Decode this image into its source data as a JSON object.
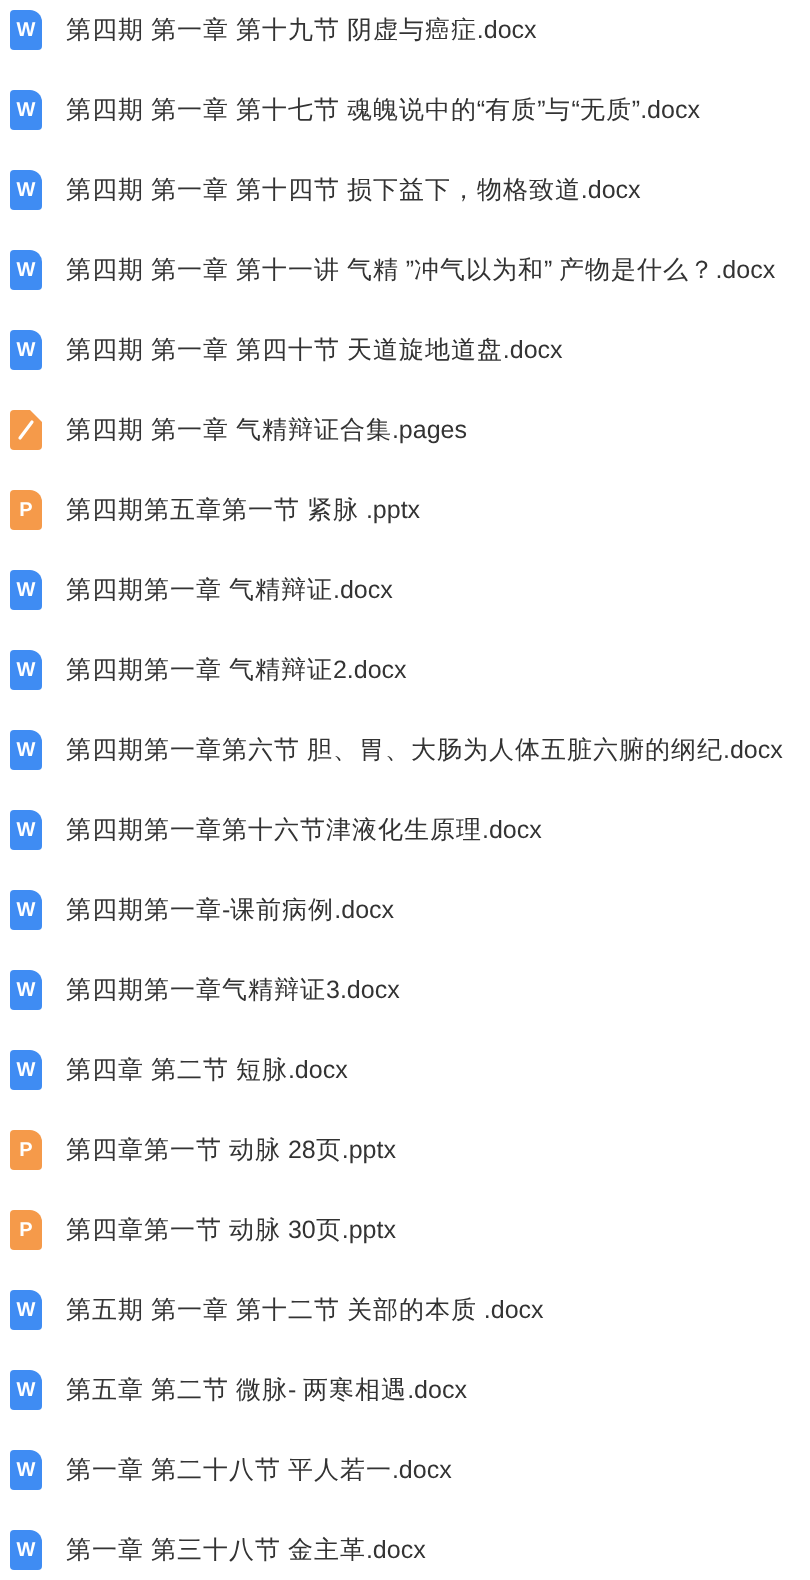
{
  "files": [
    {
      "kind": "word",
      "icon_letter": "W",
      "name": "第四期 第一章 第十九节 阴虚与癌症.docx"
    },
    {
      "kind": "word",
      "icon_letter": "W",
      "name": "第四期 第一章 第十七节 魂魄说中的“有质”与“无质”.docx"
    },
    {
      "kind": "word",
      "icon_letter": "W",
      "name": "第四期 第一章 第十四节 损下益下，物格致道.docx"
    },
    {
      "kind": "word",
      "icon_letter": "W",
      "name": "第四期 第一章 第十一讲 气精 ”冲气以为和” 产物是什么？.docx"
    },
    {
      "kind": "word",
      "icon_letter": "W",
      "name": "第四期 第一章 第四十节 天道旋地道盘.docx"
    },
    {
      "kind": "pages",
      "name": "第四期 第一章 气精辩证合集.pages"
    },
    {
      "kind": "ppt",
      "icon_letter": "P",
      "name": "第四期第五章第一节 紧脉 .pptx"
    },
    {
      "kind": "word",
      "icon_letter": "W",
      "name": "第四期第一章  气精辩证.docx"
    },
    {
      "kind": "word",
      "icon_letter": "W",
      "name": "第四期第一章 气精辩证2.docx"
    },
    {
      "kind": "word",
      "icon_letter": "W",
      "name": "第四期第一章第六节 胆、胃、大肠为人体五脏六腑的纲纪.docx"
    },
    {
      "kind": "word",
      "icon_letter": "W",
      "name": "第四期第一章第十六节津液化生原理.docx"
    },
    {
      "kind": "word",
      "icon_letter": "W",
      "name": "第四期第一章-课前病例.docx"
    },
    {
      "kind": "word",
      "icon_letter": "W",
      "name": "第四期第一章气精辩证3.docx"
    },
    {
      "kind": "word",
      "icon_letter": "W",
      "name": "第四章 第二节 短脉.docx"
    },
    {
      "kind": "ppt",
      "icon_letter": "P",
      "name": "第四章第一节 动脉 28页.pptx"
    },
    {
      "kind": "ppt",
      "icon_letter": "P",
      "name": "第四章第一节 动脉 30页.pptx"
    },
    {
      "kind": "word",
      "icon_letter": "W",
      "name": "第五期 第一章 第十二节 关部的本质 .docx"
    },
    {
      "kind": "word",
      "icon_letter": "W",
      "name": "第五章 第二节 微脉- 两寒相遇.docx"
    },
    {
      "kind": "word",
      "icon_letter": "W",
      "name": "第一章 第二十八节 平人若一.docx"
    },
    {
      "kind": "word",
      "icon_letter": "W",
      "name": "第一章 第三十八节 金主革.docx"
    }
  ]
}
